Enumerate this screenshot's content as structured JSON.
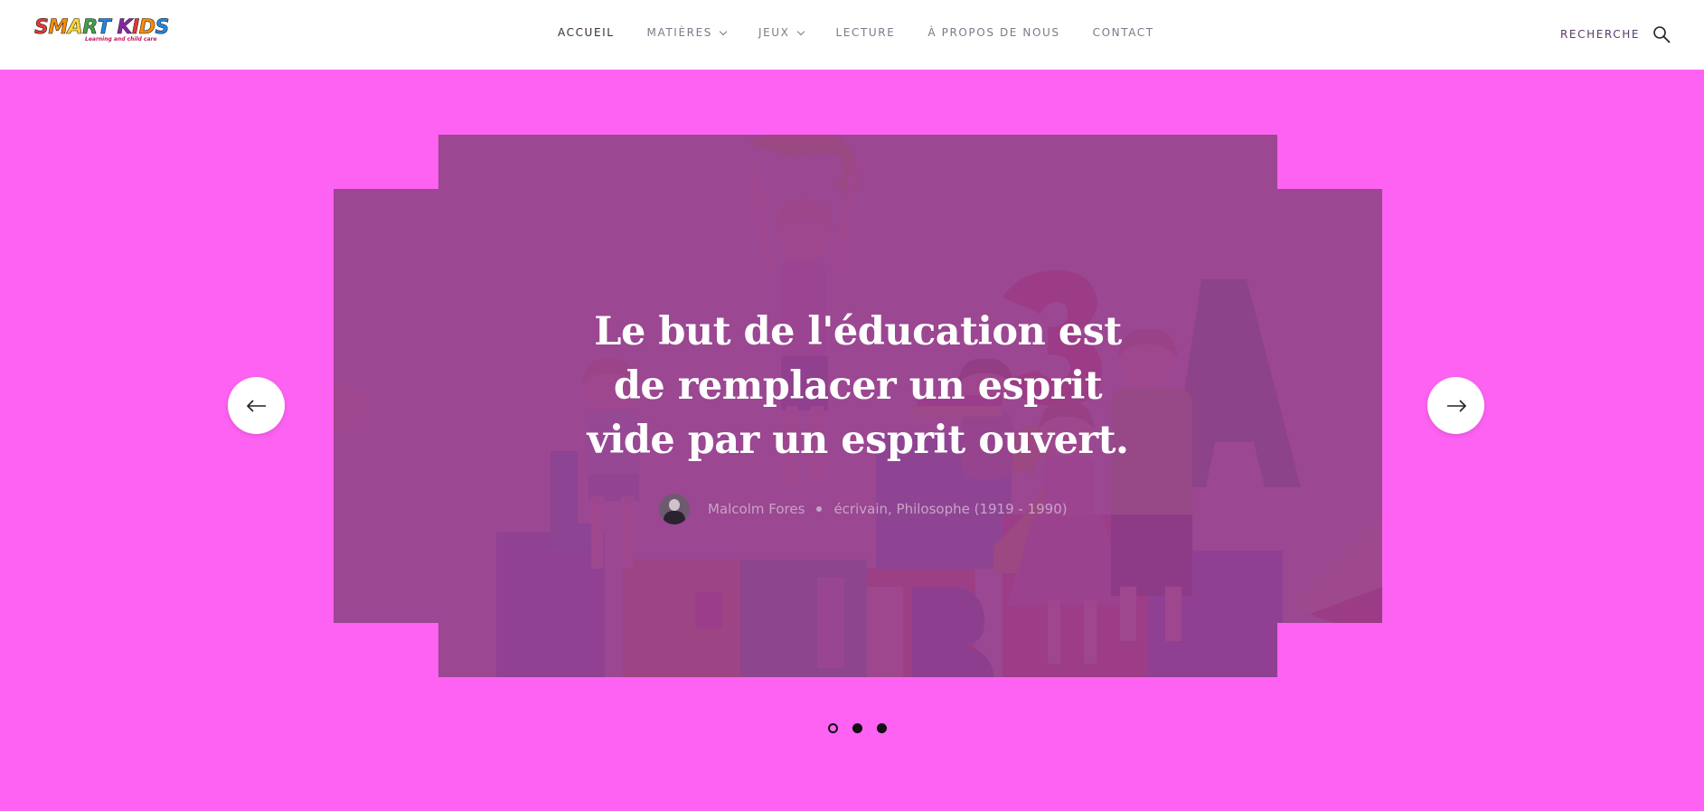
{
  "header": {
    "logo_text": "SMART KIDS",
    "logo_tagline": "Learning and child care",
    "nav": [
      {
        "label": "ACCUEIL",
        "active": true,
        "has_dropdown": false
      },
      {
        "label": "MATIÈRES",
        "active": false,
        "has_dropdown": true
      },
      {
        "label": "JEUX",
        "active": false,
        "has_dropdown": true
      },
      {
        "label": "LECTURE",
        "active": false,
        "has_dropdown": false
      },
      {
        "label": "À PROPOS DE NOUS",
        "active": false,
        "has_dropdown": false
      },
      {
        "label": "CONTACT",
        "active": false,
        "has_dropdown": false
      }
    ],
    "search_label": "RECHERCHE",
    "search_icon": "search-icon"
  },
  "slider": {
    "quote": "Le but de l'éducation est de remplacer un esprit vide par un esprit ouvert.",
    "author_name": "Malcolm Fores",
    "author_role": "écrivain, Philosophe (1919 - 1990)",
    "prev_icon": "arrow-left-icon",
    "next_icon": "arrow-right-icon",
    "dots": [
      {
        "active": true
      },
      {
        "active": false
      },
      {
        "active": false
      }
    ]
  },
  "colors": {
    "page_background": "#fe62f2",
    "overlay": "#963c8c",
    "header_background": "#ffffff"
  }
}
